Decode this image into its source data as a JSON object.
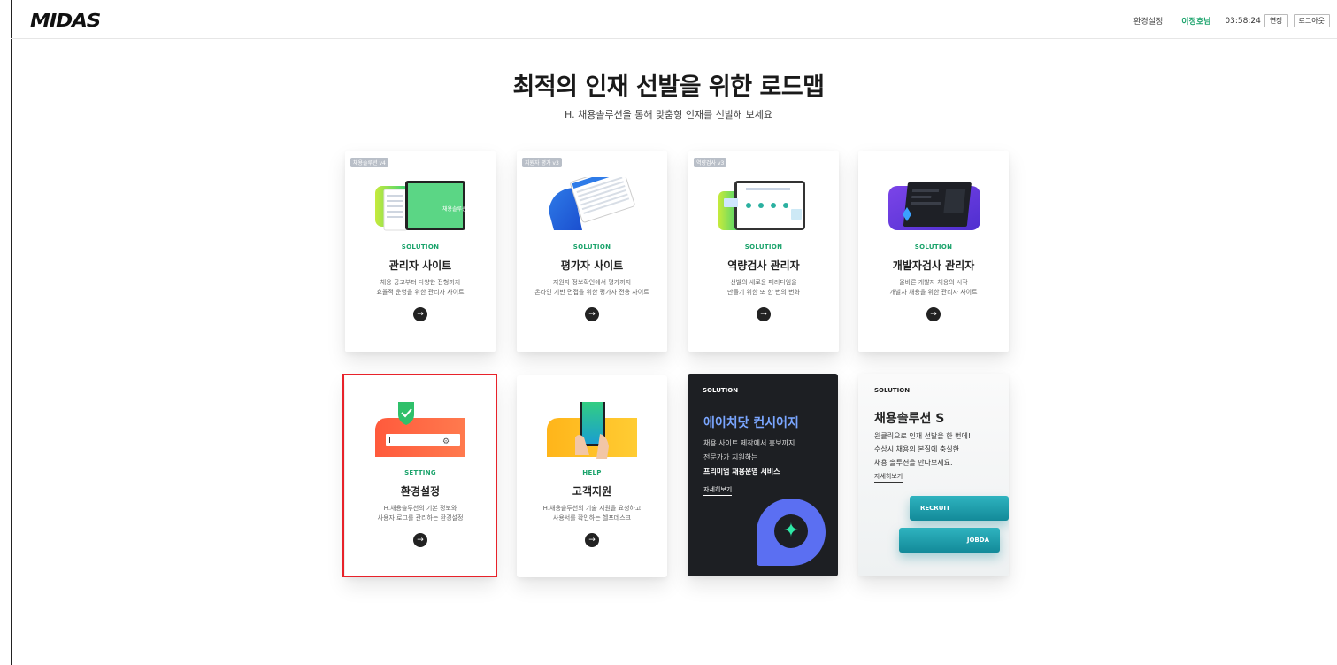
{
  "header": {
    "logo": "MIDAS",
    "settings": "환경설정",
    "user": "이정호님",
    "time": "03:58:24",
    "extend_label": "연장",
    "logout_label": "로그아웃"
  },
  "hero": {
    "title": "최적의 인재 선발을 위한 로드맵",
    "subtitle": "H. 채용솔루션을 통해 맞춤형 인재를 선발해 보세요"
  },
  "cards": [
    {
      "version": "채용솔루션 v4",
      "category": "SOLUTION",
      "title": "관리자 사이트",
      "desc1": "채용 공고부터 다양한 전형까지",
      "desc2": "효율적 운영을 위한 관리자 사이트",
      "art_text": "채용솔루션"
    },
    {
      "version": "지원자 평가 v3",
      "category": "SOLUTION",
      "title": "평가자 사이트",
      "desc1": "지원자 정보확인에서 평가까지",
      "desc2": "온라인 기반 면접을 위한 평가자 전용 사이트"
    },
    {
      "version": "역량검사 v3",
      "category": "SOLUTION",
      "title": "역량검사 관리자",
      "desc1": "선발의 새로운 패러다임을",
      "desc2": "만들기 위한 또 한 번의 변화"
    },
    {
      "category": "SOLUTION",
      "title": "개발자검사 관리자",
      "desc1": "올바른 개발자 채용의 시작",
      "desc2": "개발자 채용을 위한 관리자 사이트"
    },
    {
      "category": "SETTING",
      "title": "환경설정",
      "desc1": "H.채용솔루션의 기본 정보와",
      "desc2": "사용자 로그를 관리하는 환경설정"
    },
    {
      "category": "HELP",
      "title": "고객지원",
      "desc1": "H.채용솔루션의 기술 지원을 요청하고",
      "desc2": "사용서를 확인하는 헬프데스크"
    }
  ],
  "promo_dark": {
    "tag": "SOLUTION",
    "title": "에이치닷 컨시어지",
    "line1": "채용 사이트 제작에서 홍보까지",
    "line2": "전문가가 지원하는",
    "line3": "프리미엄 채용운영 서비스",
    "more": "자세히보기"
  },
  "promo_light": {
    "tag": "SOLUTION",
    "title": "채용솔루션 S",
    "line1": "원클릭으로 인재 선발을 한 번에!",
    "line2": "수상시 채용의 본질에 충실한",
    "line3": "채용 솔루션을 만나보세요.",
    "more": "자세히보기",
    "slab1": "RECRUIT",
    "slab2": "JOBDA"
  },
  "colors": {
    "accent_green": "#1aa36b",
    "highlight_red": "#e8222a",
    "dark_card": "#1d1f23"
  }
}
